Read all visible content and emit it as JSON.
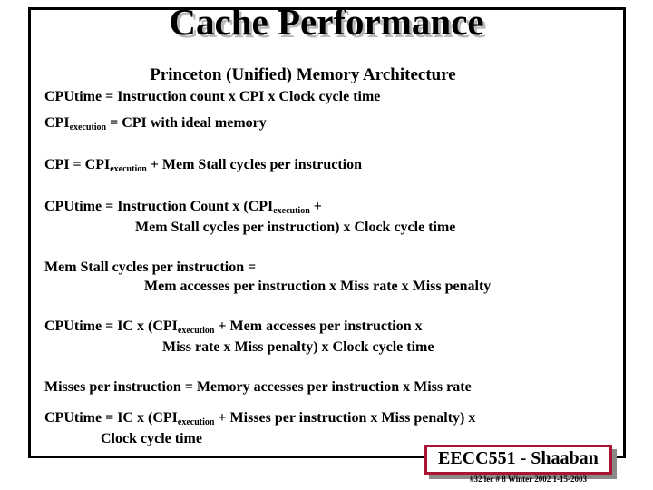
{
  "slide": {
    "title": "Cache Performance",
    "subheading": "Princeton (Unified) Memory Architecture",
    "equations": {
      "cputime_basic_label": "CPUtime = ",
      "cputime_basic_rhs": " Instruction count x  CPI  x  Clock cycle time",
      "cpi_exec_label": "CPI",
      "cpi_exec_sub": "execution",
      "cpi_exec_rhs": "  =   CPI with ideal memory",
      "cpi_label": "CPI =    CPI",
      "cpi_sub": "execution",
      "cpi_rhs": "  +   Mem Stall cycles per instruction",
      "cputime_stall_l1a": "CPUtime  =  Instruction Count x   (CPI",
      "cputime_stall_l1sub": "execution",
      "cputime_stall_l1b": "  +",
      "cputime_stall_l2": "Mem Stall  cycles per instruction)    x   Clock cycle time",
      "memstall_l1": "Mem Stall  cycles per instruction =",
      "memstall_l2": "Mem accesses per instruction  x  Miss rate x Miss penalty",
      "cputime_acc_l1a": "CPUtime  =  IC x  (CPI",
      "cputime_acc_l1sub": "execution",
      "cputime_acc_l1b": " +  Mem accesses per instruction  x",
      "cputime_acc_l2": "Miss rate x Miss penalty)  x   Clock cycle time",
      "misses_line": "Misses per instruction =  Memory accesses per instruction  x  Miss rate",
      "cputime_miss_l1a": "CPUtime =  IC x (CPI",
      "cputime_miss_l1sub": "execution",
      "cputime_miss_l1b": " + Misses per instruction  x  Miss penalty) x",
      "cputime_miss_l2": "Clock cycle time"
    }
  },
  "footer": {
    "badge_text": "EECC551 - Shaaban",
    "subtext": "#32   lec # 8   Winter 2002  1-15-2003",
    "badge_border_color": "#a81535",
    "badge_shadow_color": "#8a8a8a"
  },
  "theme": {
    "background": "#ffffff",
    "text_color": "#000000",
    "frame_color": "#000000",
    "title_shadow_color": "#b9b9b9"
  }
}
